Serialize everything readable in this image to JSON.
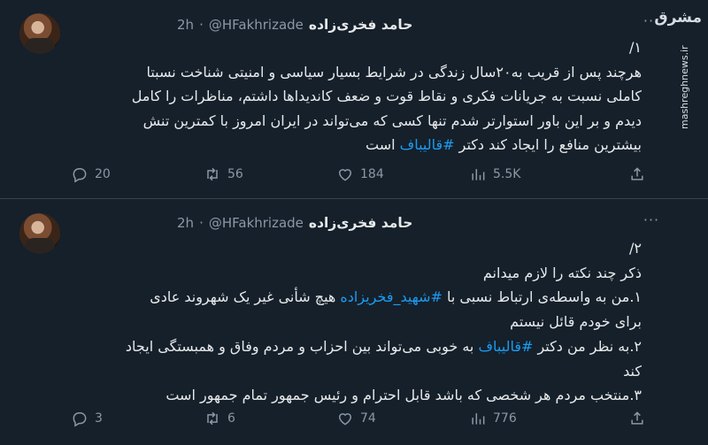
{
  "watermark": {
    "logo": "مشرق",
    "url": "mashreghnews.ir"
  },
  "tweets": [
    {
      "author": {
        "display_name": "حامد فخری‌زاده",
        "handle": "@HFakhrizade",
        "time": "2h"
      },
      "number": "۱/",
      "lines": [
        {
          "text": "هرچند پس از قریب به۲۰سال زندگی در شرایط بسیار سیاسی و امنیتی شناخت نسبتا"
        },
        {
          "text": "کاملی نسبت به جریانات فکری و نقاط قوت و ضعف کاندیداها داشتم، مناظرات را کامل"
        },
        {
          "text": "دیدم و بر این باور استوارتر شدم تنها کسی که می‌تواند در ایران امروز با کمترین تنش"
        },
        {
          "before": "بیشترین منافع را ایجاد کند دکتر ",
          "hashtag": "#قالیباف",
          "after": " است"
        }
      ],
      "stats": {
        "replies": "20",
        "retweets": "56",
        "likes": "184",
        "views": "5.5K"
      }
    },
    {
      "author": {
        "display_name": "حامد فخری‌زاده",
        "handle": "@HFakhrizade",
        "time": "2h"
      },
      "number": "۲/",
      "lines": [
        {
          "text": "ذکر چند نکته را لازم میدانم"
        },
        {
          "before": "۱.من به واسطه‌ی ارتباط نسبی با ",
          "hashtag": "#شهید_فخریزاده",
          "after": " هیچ شأنی غیر یک شهروند عادی"
        },
        {
          "text": "برای خودم قائل نیستم"
        },
        {
          "before": "۲.به نظر من دکتر ",
          "hashtag": "#قالیباف",
          "after": " به خوبی می‌تواند بین احزاب و مردم وفاق و همبستگی ایجاد"
        },
        {
          "text": "کند"
        },
        {
          "text": "۳.منتخب مردم هر شخصی که باشد قابل احترام و رئیس جمهور تمام جمهور است"
        }
      ],
      "stats": {
        "replies": "3",
        "retweets": "6",
        "likes": "74",
        "views": "776"
      }
    }
  ]
}
